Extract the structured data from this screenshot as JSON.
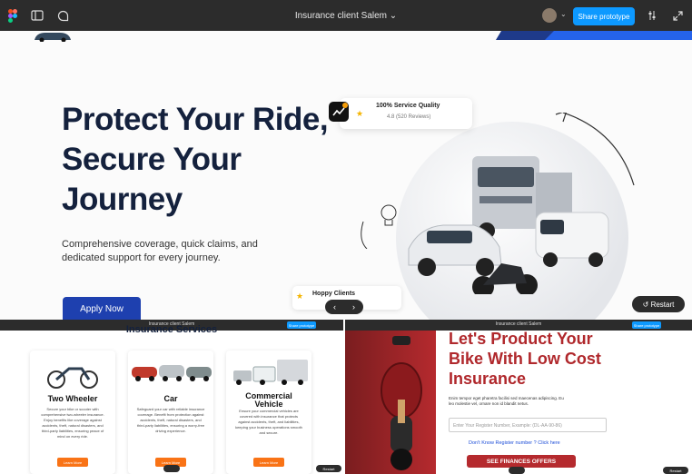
{
  "app": {
    "title": "Insurance client Salem",
    "share_label": "Share prototype"
  },
  "hero": {
    "title_line1": "Protect Your Ride,",
    "title_line2": "Secure Your",
    "title_line3": "Journey",
    "subtitle_line1": "Comprehensive coverage, quick claims, and",
    "subtitle_line2": "dedicated support for every journey.",
    "apply_label": "Apply Now",
    "badge_title": "100% Service Quality",
    "badge_rating": "4.8 (520 Reviews)",
    "happy_clients": "Hoppy Clients",
    "restart_label": "Restart"
  },
  "services": {
    "title": "Insurance Services",
    "cards": [
      {
        "title": "Two Wheeler",
        "desc": "Secure your bike or scooter with comprehensive two-wheeler insurance. Enjoy benefits like coverage against accidents, theft, natural disasters, and third-party liabilities, ensuring peace of mind on every ride.",
        "button": "Learn More"
      },
      {
        "title": "Car",
        "desc": "Safeguard your car with reliable insurance coverage. Benefit from protection against accidents, theft, natural disasters, and third-party liabilities, ensuring a worry-free driving experience.",
        "button": "Learn More"
      },
      {
        "title_line1": "Commercial",
        "title_line2": "Vehicle",
        "desc": "Ensure your commercial vehicles are covered with insurance that protects against accidents, theft, and liabilities, keeping your business operations smooth and secure.",
        "button": "Learn More"
      }
    ],
    "restart_label": "Restart"
  },
  "product": {
    "title_line1": "Let's Product Your",
    "title_line2": "Bike With Low Cost",
    "title_line3": "Insurance",
    "desc": "Enim tempor eget pharetra facilisi sed maecenas adipiscing. Eu leo molestie vel, ornare non id blandit netus.",
    "input_placeholder": "Enter Your Register Number, Example: (DL-AA-90-86)",
    "link_text": "Don't Know Register number ? Click here",
    "button": "SEE FINANCES OFFERS",
    "restart_label": "Restart"
  },
  "colors": {
    "accent": "#0d99ff",
    "navy": "#14213d",
    "apply": "#1e40af",
    "orange": "#f97316",
    "red": "#b0282c"
  }
}
